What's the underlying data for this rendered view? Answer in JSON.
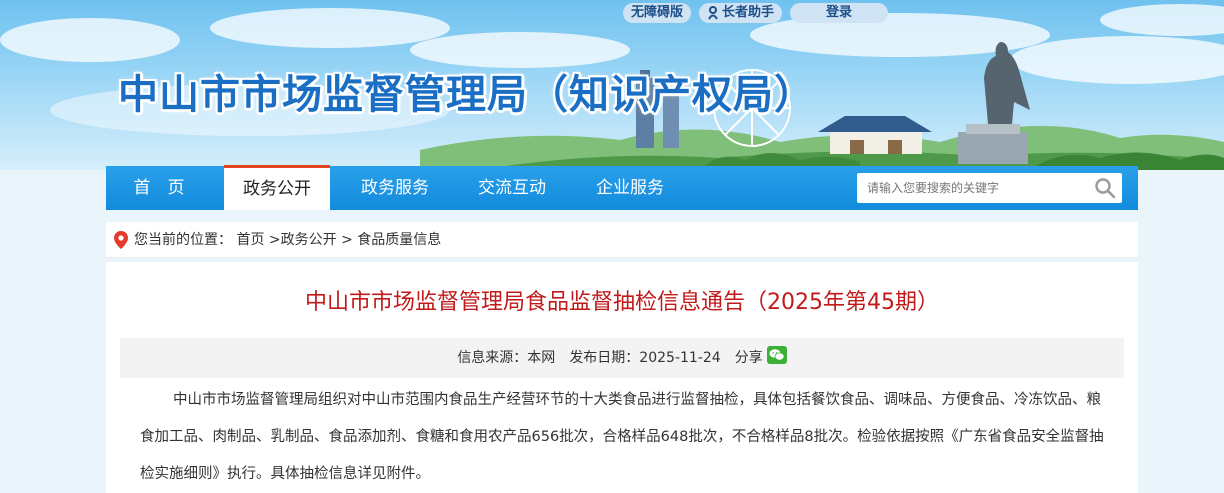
{
  "site": {
    "title": "中山市市场监督管理局（知识产权局）"
  },
  "utility": {
    "accessible": "无障碍版",
    "elder": "长者助手",
    "login": "登录"
  },
  "nav": {
    "items": [
      {
        "label": "首　页"
      },
      {
        "label": "政务公开"
      },
      {
        "label": "政务服务"
      },
      {
        "label": "交流互动"
      },
      {
        "label": "企业服务"
      }
    ],
    "active_index": 1
  },
  "search": {
    "placeholder": "请输入您要搜索的关键字",
    "value": ""
  },
  "breadcrumb": {
    "prefix": "您当前的位置：",
    "items": [
      "首页",
      "政务公开",
      "食品质量信息"
    ]
  },
  "article": {
    "title": "中山市市场监督管理局食品监督抽检信息通告（2025年第45期）",
    "source": "信息来源：本网",
    "date": "发布日期：2025-11-24",
    "share": "分享",
    "body": "中山市市场监督管理局组织对中山市范围内食品生产经营环节的十大类食品进行监督抽检，具体包括餐饮食品、调味品、方便食品、冷冻饮品、粮食加工品、肉制品、乳制品、食品添加剂、食糖和食用农产品656批次，合格样品648批次，不合格样品8批次。检验依据按照《广东省食品安全监督抽检实施细则》执行。具体抽检信息详见附件。"
  },
  "colors": {
    "nav_blue": "#1a93e2",
    "title_red": "#c11a1a",
    "site_title_blue": "#1a6fc4",
    "active_accent": "#e0451f",
    "pin_red": "#e63a2c",
    "wechat_green": "#3cb034"
  },
  "icons": [
    "accessibility-icon",
    "elder-icon",
    "search-icon",
    "location-pin-icon",
    "wechat-icon"
  ]
}
